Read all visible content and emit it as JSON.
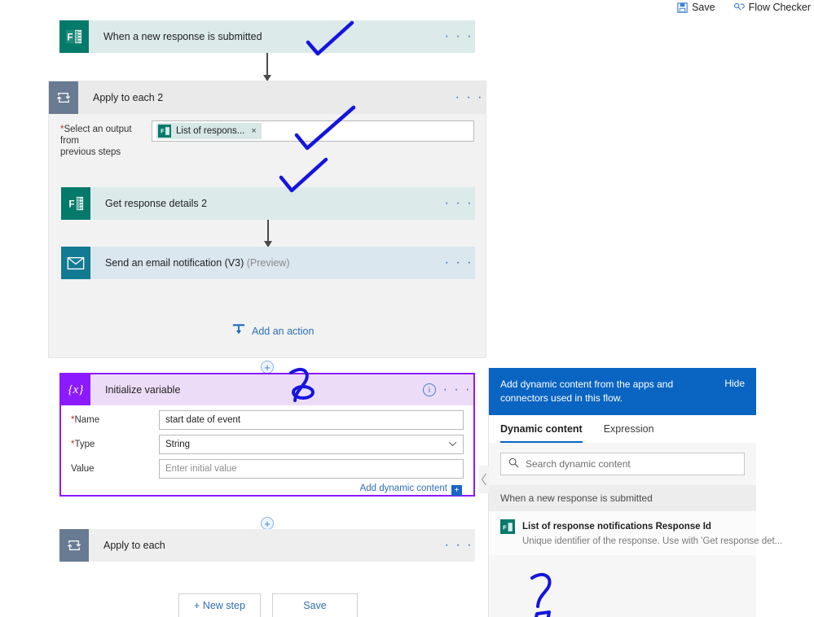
{
  "commandbar": {
    "items": [
      {
        "label": "Save",
        "icon": "save-icon"
      },
      {
        "label": "Flow Checker",
        "icon": "flow-checker-icon"
      }
    ]
  },
  "flow": {
    "trigger": {
      "title": "When a new response is submitted",
      "icon": "microsoft-forms-icon",
      "menu": "· · ·"
    },
    "scope": {
      "title": "Apply to each 2",
      "icon": "loop-icon",
      "menu": "· · ·",
      "field": {
        "label_line1": "Select an output from",
        "label_line2": "previous steps",
        "required_mark": "*",
        "token": "List of respons...",
        "token_remove": "×",
        "token_icon": "microsoft-forms-icon"
      },
      "actions": [
        {
          "title": "Get response details 2",
          "preview": "",
          "icon": "microsoft-forms-icon",
          "menu": "· · ·"
        },
        {
          "title": "Send an email notification (V3)",
          "preview": "(Preview)",
          "icon": "mail-icon",
          "menu": "· · ·"
        }
      ],
      "add_action": {
        "label": "Add an action",
        "icon": "add-action-icon"
      }
    },
    "initialize_variable": {
      "title": "Initialize variable",
      "icon": "variable-icon",
      "icon_glyph": "{x}",
      "info": "i",
      "menu": "· · ·",
      "fields": [
        {
          "label": "Name",
          "required": "*",
          "value": "start date of event",
          "placeholder": "",
          "type": "text"
        },
        {
          "label": "Type",
          "required": "*",
          "value": "String",
          "placeholder": "",
          "type": "select"
        },
        {
          "label": "Value",
          "required": "",
          "value": "",
          "placeholder": "Enter initial value",
          "type": "text"
        }
      ],
      "add_dynamic_content": {
        "label": "Add dynamic content",
        "plus": "+"
      }
    },
    "apply_to_each": {
      "title": "Apply to each",
      "icon": "loop-icon",
      "menu": "· · ·"
    },
    "plus_node": "+",
    "buttons": [
      {
        "label": "+ New step",
        "name": "new-step-button"
      },
      {
        "label": "Save",
        "name": "save-button"
      }
    ]
  },
  "dynamic_panel": {
    "header_text": "Add dynamic content from the apps and connectors used in this flow.",
    "hide_label": "Hide",
    "tabs": [
      {
        "label": "Dynamic content",
        "active": true
      },
      {
        "label": "Expression",
        "active": false
      }
    ],
    "search_placeholder": "Search dynamic content",
    "search_icon": "search-icon",
    "groups": [
      {
        "name": "When a new response is submitted",
        "items": [
          {
            "name": "List of response notifications Response Id",
            "description": "Unique identifier of the response. Use with 'Get response det...",
            "icon": "microsoft-forms-icon"
          }
        ]
      }
    ],
    "collapse_icon": "chevron-left-icon"
  },
  "colors": {
    "accent_blue": "#0a64c2",
    "link_blue": "#2f6fb5",
    "forms_green": "#057a6b",
    "mail_teal": "#127a92",
    "loop_slate": "#697b93",
    "variable_purple": "#8c1aff",
    "card_teal_bg": "#dceaea",
    "ink_blue": "#1414e0"
  }
}
